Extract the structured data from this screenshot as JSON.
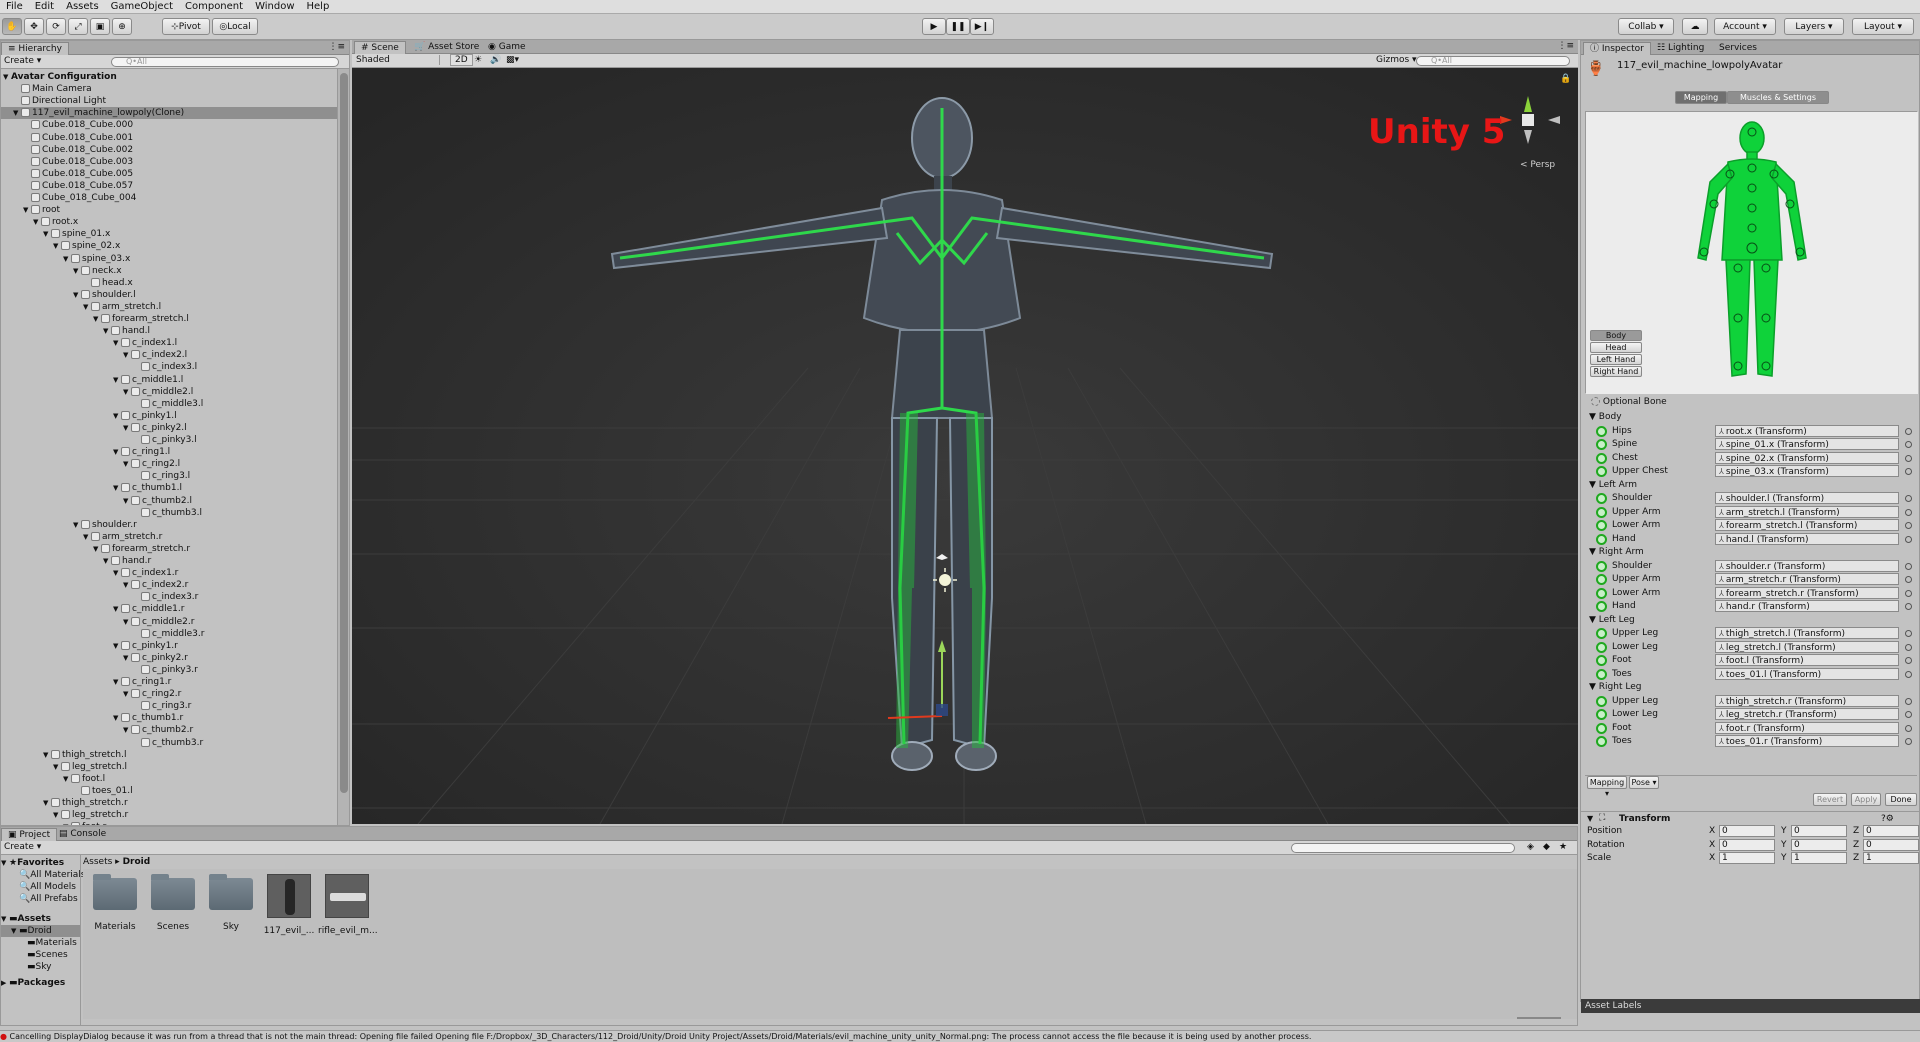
{
  "menu": [
    "File",
    "Edit",
    "Assets",
    "GameObject",
    "Component",
    "Window",
    "Help"
  ],
  "toolbar": {
    "pivot_label": "Pivot",
    "local_label": "Local",
    "collab_label": "Collab ▾",
    "account_label": "Account ▾",
    "layers_label": "Layers ▾",
    "layout_label": "Layout ▾"
  },
  "hierarchy": {
    "tab_label": "Hierarchy",
    "create_label": "Create ▾",
    "search_placeholder": "Q•All",
    "rows": [
      {
        "depth": 0,
        "label": "Avatar Configuration",
        "bold": true,
        "arrow": "▼"
      },
      {
        "depth": 1,
        "label": "Main Camera",
        "arrow": ""
      },
      {
        "depth": 1,
        "label": "Directional Light",
        "arrow": ""
      },
      {
        "depth": 1,
        "label": "117_evil_machine_lowpoly(Clone)",
        "arrow": "▼",
        "selected": true
      },
      {
        "depth": 2,
        "label": "Cube.018_Cube.000",
        "arrow": ""
      },
      {
        "depth": 2,
        "label": "Cube.018_Cube.001",
        "arrow": ""
      },
      {
        "depth": 2,
        "label": "Cube.018_Cube.002",
        "arrow": ""
      },
      {
        "depth": 2,
        "label": "Cube.018_Cube.003",
        "arrow": ""
      },
      {
        "depth": 2,
        "label": "Cube.018_Cube.005",
        "arrow": ""
      },
      {
        "depth": 2,
        "label": "Cube.018_Cube.057",
        "arrow": ""
      },
      {
        "depth": 2,
        "label": "Cube_018_Cube_004",
        "arrow": ""
      },
      {
        "depth": 2,
        "label": "root",
        "arrow": "▼"
      },
      {
        "depth": 3,
        "label": "root.x",
        "arrow": "▼"
      },
      {
        "depth": 4,
        "label": "spine_01.x",
        "arrow": "▼"
      },
      {
        "depth": 5,
        "label": "spine_02.x",
        "arrow": "▼"
      },
      {
        "depth": 6,
        "label": "spine_03.x",
        "arrow": "▼"
      },
      {
        "depth": 7,
        "label": "neck.x",
        "arrow": "▼"
      },
      {
        "depth": 8,
        "label": "head.x",
        "arrow": ""
      },
      {
        "depth": 7,
        "label": "shoulder.l",
        "arrow": "▼"
      },
      {
        "depth": 8,
        "label": "arm_stretch.l",
        "arrow": "▼"
      },
      {
        "depth": 9,
        "label": "forearm_stretch.l",
        "arrow": "▼"
      },
      {
        "depth": 10,
        "label": "hand.l",
        "arrow": "▼"
      },
      {
        "depth": 11,
        "label": "c_index1.l",
        "arrow": "▼"
      },
      {
        "depth": 12,
        "label": "c_index2.l",
        "arrow": "▼"
      },
      {
        "depth": 13,
        "label": "c_index3.l",
        "arrow": ""
      },
      {
        "depth": 11,
        "label": "c_middle1.l",
        "arrow": "▼"
      },
      {
        "depth": 12,
        "label": "c_middle2.l",
        "arrow": "▼"
      },
      {
        "depth": 13,
        "label": "c_middle3.l",
        "arrow": ""
      },
      {
        "depth": 11,
        "label": "c_pinky1.l",
        "arrow": "▼"
      },
      {
        "depth": 12,
        "label": "c_pinky2.l",
        "arrow": "▼"
      },
      {
        "depth": 13,
        "label": "c_pinky3.l",
        "arrow": ""
      },
      {
        "depth": 11,
        "label": "c_ring1.l",
        "arrow": "▼"
      },
      {
        "depth": 12,
        "label": "c_ring2.l",
        "arrow": "▼"
      },
      {
        "depth": 13,
        "label": "c_ring3.l",
        "arrow": ""
      },
      {
        "depth": 11,
        "label": "c_thumb1.l",
        "arrow": "▼"
      },
      {
        "depth": 12,
        "label": "c_thumb2.l",
        "arrow": "▼"
      },
      {
        "depth": 13,
        "label": "c_thumb3.l",
        "arrow": ""
      },
      {
        "depth": 7,
        "label": "shoulder.r",
        "arrow": "▼"
      },
      {
        "depth": 8,
        "label": "arm_stretch.r",
        "arrow": "▼"
      },
      {
        "depth": 9,
        "label": "forearm_stretch.r",
        "arrow": "▼"
      },
      {
        "depth": 10,
        "label": "hand.r",
        "arrow": "▼"
      },
      {
        "depth": 11,
        "label": "c_index1.r",
        "arrow": "▼"
      },
      {
        "depth": 12,
        "label": "c_index2.r",
        "arrow": "▼"
      },
      {
        "depth": 13,
        "label": "c_index3.r",
        "arrow": ""
      },
      {
        "depth": 11,
        "label": "c_middle1.r",
        "arrow": "▼"
      },
      {
        "depth": 12,
        "label": "c_middle2.r",
        "arrow": "▼"
      },
      {
        "depth": 13,
        "label": "c_middle3.r",
        "arrow": ""
      },
      {
        "depth": 11,
        "label": "c_pinky1.r",
        "arrow": "▼"
      },
      {
        "depth": 12,
        "label": "c_pinky2.r",
        "arrow": "▼"
      },
      {
        "depth": 13,
        "label": "c_pinky3.r",
        "arrow": ""
      },
      {
        "depth": 11,
        "label": "c_ring1.r",
        "arrow": "▼"
      },
      {
        "depth": 12,
        "label": "c_ring2.r",
        "arrow": "▼"
      },
      {
        "depth": 13,
        "label": "c_ring3.r",
        "arrow": ""
      },
      {
        "depth": 11,
        "label": "c_thumb1.r",
        "arrow": "▼"
      },
      {
        "depth": 12,
        "label": "c_thumb2.r",
        "arrow": "▼"
      },
      {
        "depth": 13,
        "label": "c_thumb3.r",
        "arrow": ""
      },
      {
        "depth": 4,
        "label": "thigh_stretch.l",
        "arrow": "▼"
      },
      {
        "depth": 5,
        "label": "leg_stretch.l",
        "arrow": "▼"
      },
      {
        "depth": 6,
        "label": "foot.l",
        "arrow": "▼"
      },
      {
        "depth": 7,
        "label": "toes_01.l",
        "arrow": ""
      },
      {
        "depth": 4,
        "label": "thigh_stretch.r",
        "arrow": "▼"
      },
      {
        "depth": 5,
        "label": "leg_stretch.r",
        "arrow": "▼"
      },
      {
        "depth": 6,
        "label": "foot.r",
        "arrow": "▼"
      }
    ]
  },
  "scene": {
    "tabs": [
      "Scene",
      "Asset Store",
      "Game"
    ],
    "shading_label": "Shaded",
    "mode_2d_label": "2D",
    "gizmos_label": "Gizmos ▾",
    "search_placeholder": "Q•All",
    "overlay_text": "Unity 5",
    "persp_label": "< Persp"
  },
  "inspector": {
    "tabs": [
      "Inspector",
      "Lighting",
      "Services"
    ],
    "object_name": "117_evil_machine_lowpolyAvatar",
    "mapping_label": "Mapping",
    "muscles_label": "Muscles & Settings",
    "body_buttons": [
      "Body",
      "Head",
      "Left Hand",
      "Right Hand"
    ],
    "optional_bone_label": "Optional Bone",
    "sections": [
      {
        "title": "Body",
        "bones": [
          [
            "Hips",
            "root.x (Transform)"
          ],
          [
            "Spine",
            "spine_01.x (Transform)"
          ],
          [
            "Chest",
            "spine_02.x (Transform)"
          ],
          [
            "Upper Chest",
            "spine_03.x (Transform)"
          ]
        ]
      },
      {
        "title": "Left Arm",
        "bones": [
          [
            "Shoulder",
            "shoulder.l (Transform)"
          ],
          [
            "Upper Arm",
            "arm_stretch.l (Transform)"
          ],
          [
            "Lower Arm",
            "forearm_stretch.l (Transform)"
          ],
          [
            "Hand",
            "hand.l (Transform)"
          ]
        ]
      },
      {
        "title": "Right Arm",
        "bones": [
          [
            "Shoulder",
            "shoulder.r (Transform)"
          ],
          [
            "Upper Arm",
            "arm_stretch.r (Transform)"
          ],
          [
            "Lower Arm",
            "forearm_stretch.r (Transform)"
          ],
          [
            "Hand",
            "hand.r (Transform)"
          ]
        ]
      },
      {
        "title": "Left Leg",
        "bones": [
          [
            "Upper Leg",
            "thigh_stretch.l (Transform)"
          ],
          [
            "Lower Leg",
            "leg_stretch.l (Transform)"
          ],
          [
            "Foot",
            "foot.l (Transform)"
          ],
          [
            "Toes",
            "toes_01.l (Transform)"
          ]
        ]
      },
      {
        "title": "Right Leg",
        "bones": [
          [
            "Upper Leg",
            "thigh_stretch.r (Transform)"
          ],
          [
            "Lower Leg",
            "leg_stretch.r (Transform)"
          ],
          [
            "Foot",
            "foot.r (Transform)"
          ],
          [
            "Toes",
            "toes_01.r (Transform)"
          ]
        ]
      }
    ],
    "mapping_dropdown": "Mapping ▾",
    "pose_dropdown": "Pose ▾",
    "revert_label": "Revert",
    "apply_label": "Apply",
    "done_label": "Done",
    "transform": {
      "title": "Transform",
      "rows": [
        {
          "label": "Position",
          "x": "0",
          "y": "0",
          "z": "0"
        },
        {
          "label": "Rotation",
          "x": "0",
          "y": "0",
          "z": "0"
        },
        {
          "label": "Scale",
          "x": "1",
          "y": "1",
          "z": "1"
        }
      ]
    },
    "asset_labels": "Asset Labels"
  },
  "project": {
    "tabs": [
      "Project",
      "Console"
    ],
    "create_label": "Create ▾",
    "breadcrumb": [
      "Assets",
      "Droid"
    ],
    "favorites_title": "Favorites",
    "favorites": [
      "All Materials",
      "All Models",
      "All Prefabs"
    ],
    "assets_title": "Assets",
    "asset_tree": [
      {
        "label": "Droid",
        "depth": 1,
        "selected": true
      },
      {
        "label": "Materials",
        "depth": 2
      },
      {
        "label": "Scenes",
        "depth": 2
      },
      {
        "label": "Sky",
        "depth": 2
      }
    ],
    "packages_title": "Packages",
    "items": [
      {
        "label": "Materials",
        "kind": "folder"
      },
      {
        "label": "Scenes",
        "kind": "folder"
      },
      {
        "label": "Sky",
        "kind": "folder"
      },
      {
        "label": "117_evil_...",
        "kind": "model"
      },
      {
        "label": "rifle_evil_m...",
        "kind": "model"
      }
    ]
  },
  "status_message": "Cancelling DisplayDialog because it was run from a thread that is not the main thread: Opening file failed Opening file F:/Dropbox/_3D_Characters/112_Droid/Unity/Droid Unity Project/Assets/Droid/Materials/evil_machine_unity_unity_Normal.png: The process cannot access the file because it is being used by another process."
}
